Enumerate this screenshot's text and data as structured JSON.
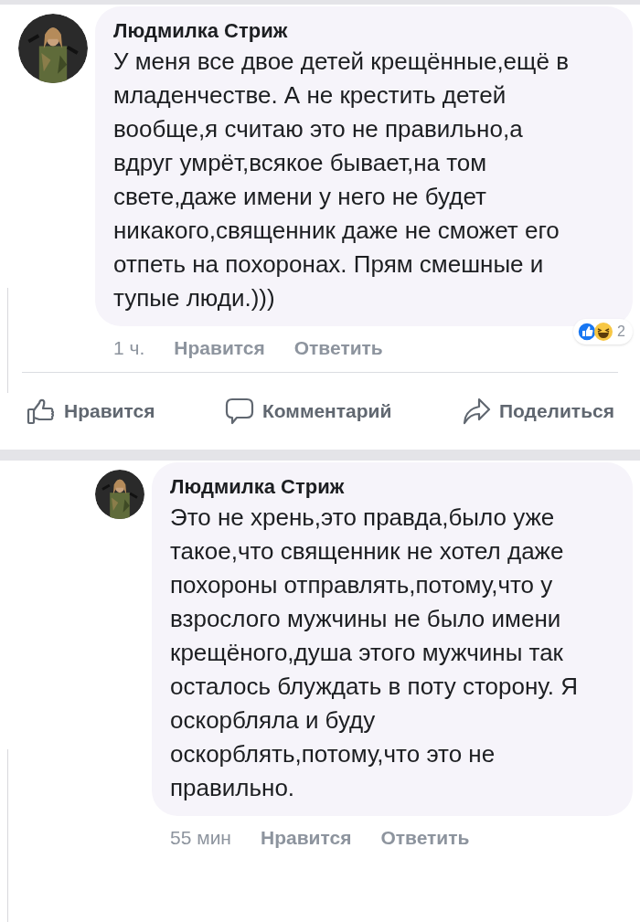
{
  "comment_top": {
    "author": "Людмилка Стриж",
    "text": "У меня все двое детей крещённые,ещё в младенчестве. А не крестить детей вообще,я считаю это не правильно,а вдруг умрёт,всякое бывает,на том свете,даже имени у него не будет никакого,священник даже не сможет его отпеть на похоронах. Прям смешные и тупые люди.)))",
    "time": "1 ч.",
    "actions": [
      "Нравится",
      "Ответить"
    ],
    "reaction_count": "2"
  },
  "post_actions": [
    {
      "kind": "like",
      "label": "Нравится"
    },
    {
      "kind": "comment",
      "label": "Комментарий"
    },
    {
      "kind": "share",
      "label": "Поделиться"
    }
  ],
  "comment_bottom": {
    "author": "Людмилка Стриж",
    "text": "Это не хрень,это правда,было уже такое,что священник не хотел даже похороны отправлять,потому,что у взрослого мужчины не было имени крещёного,душа этого мужчины так осталось блуждать в поту сторону. Я оскорбляла и буду оскорблять,потому,что это не правильно.",
    "time": "55 мин",
    "actions": [
      "Нравится",
      "Ответить"
    ]
  }
}
